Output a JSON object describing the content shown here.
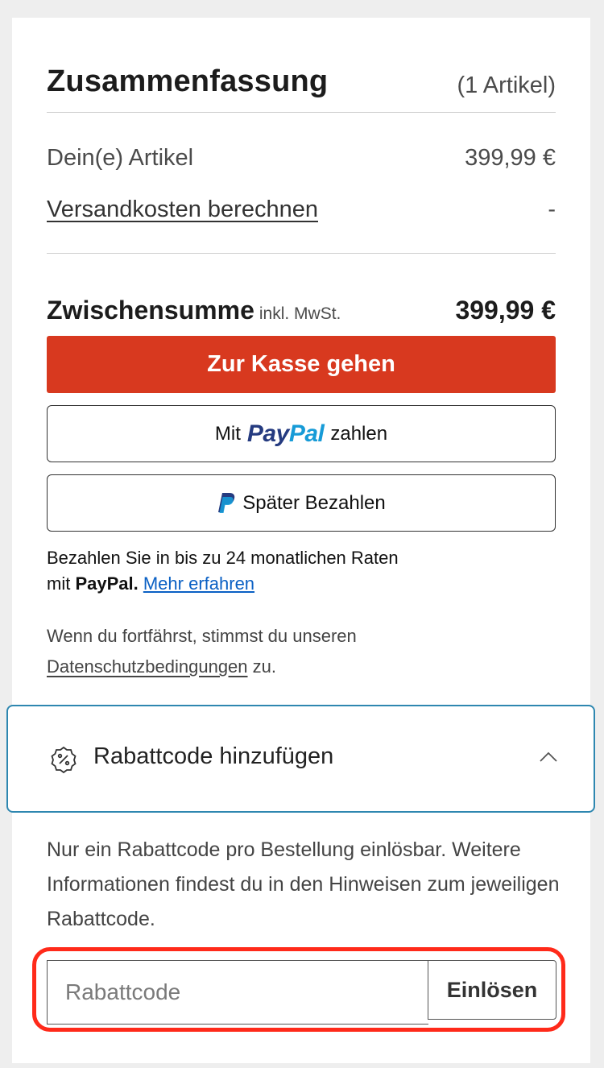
{
  "summary": {
    "title": "Zusammenfassung",
    "item_count": "(1 Artikel)",
    "items_label": "Dein(e) Artikel",
    "items_value": "399,99 €",
    "shipping_label": "Versandkosten berechnen",
    "shipping_value": "-",
    "subtotal_label": "Zwischensumme",
    "subtotal_note": "inkl. MwSt.",
    "subtotal_value": "399,99 €"
  },
  "actions": {
    "checkout_label": "Zur Kasse gehen",
    "paypal_prefix": "Mit",
    "paypal_brand_dark": "Pay",
    "paypal_brand_light": "Pal",
    "paypal_suffix": "zahlen",
    "paylater_label": "Später Bezahlen"
  },
  "paypal_info": {
    "text_line1": "Bezahlen Sie in bis zu 24 monatlichen Raten",
    "text_prefix": "mit",
    "brand": "PayPal.",
    "link": "Mehr erfahren"
  },
  "privacy": {
    "text": "Wenn du fortfährst, stimmst du unseren",
    "link": "Datenschutzbedingungen",
    "suffix": "zu."
  },
  "discount": {
    "toggle_label": "Rabattcode hinzufügen",
    "icon": "discount-badge-icon",
    "expanded_icon": "chevron-up-icon",
    "info_text": "Nur ein Rabattcode pro Bestellung einlösbar. Weitere Informationen findest du in den Hinweisen zum jeweiligen Rabattcode.",
    "input_placeholder": "Rabattcode",
    "input_value": "",
    "redeem_label": "Einlösen"
  },
  "colors": {
    "checkout": "#d8391f",
    "paypal_dark": "#253b80",
    "paypal_light": "#179bd7",
    "link": "#0a60c4",
    "discount_border": "#2e87b0",
    "highlight": "#ff2a1a"
  }
}
